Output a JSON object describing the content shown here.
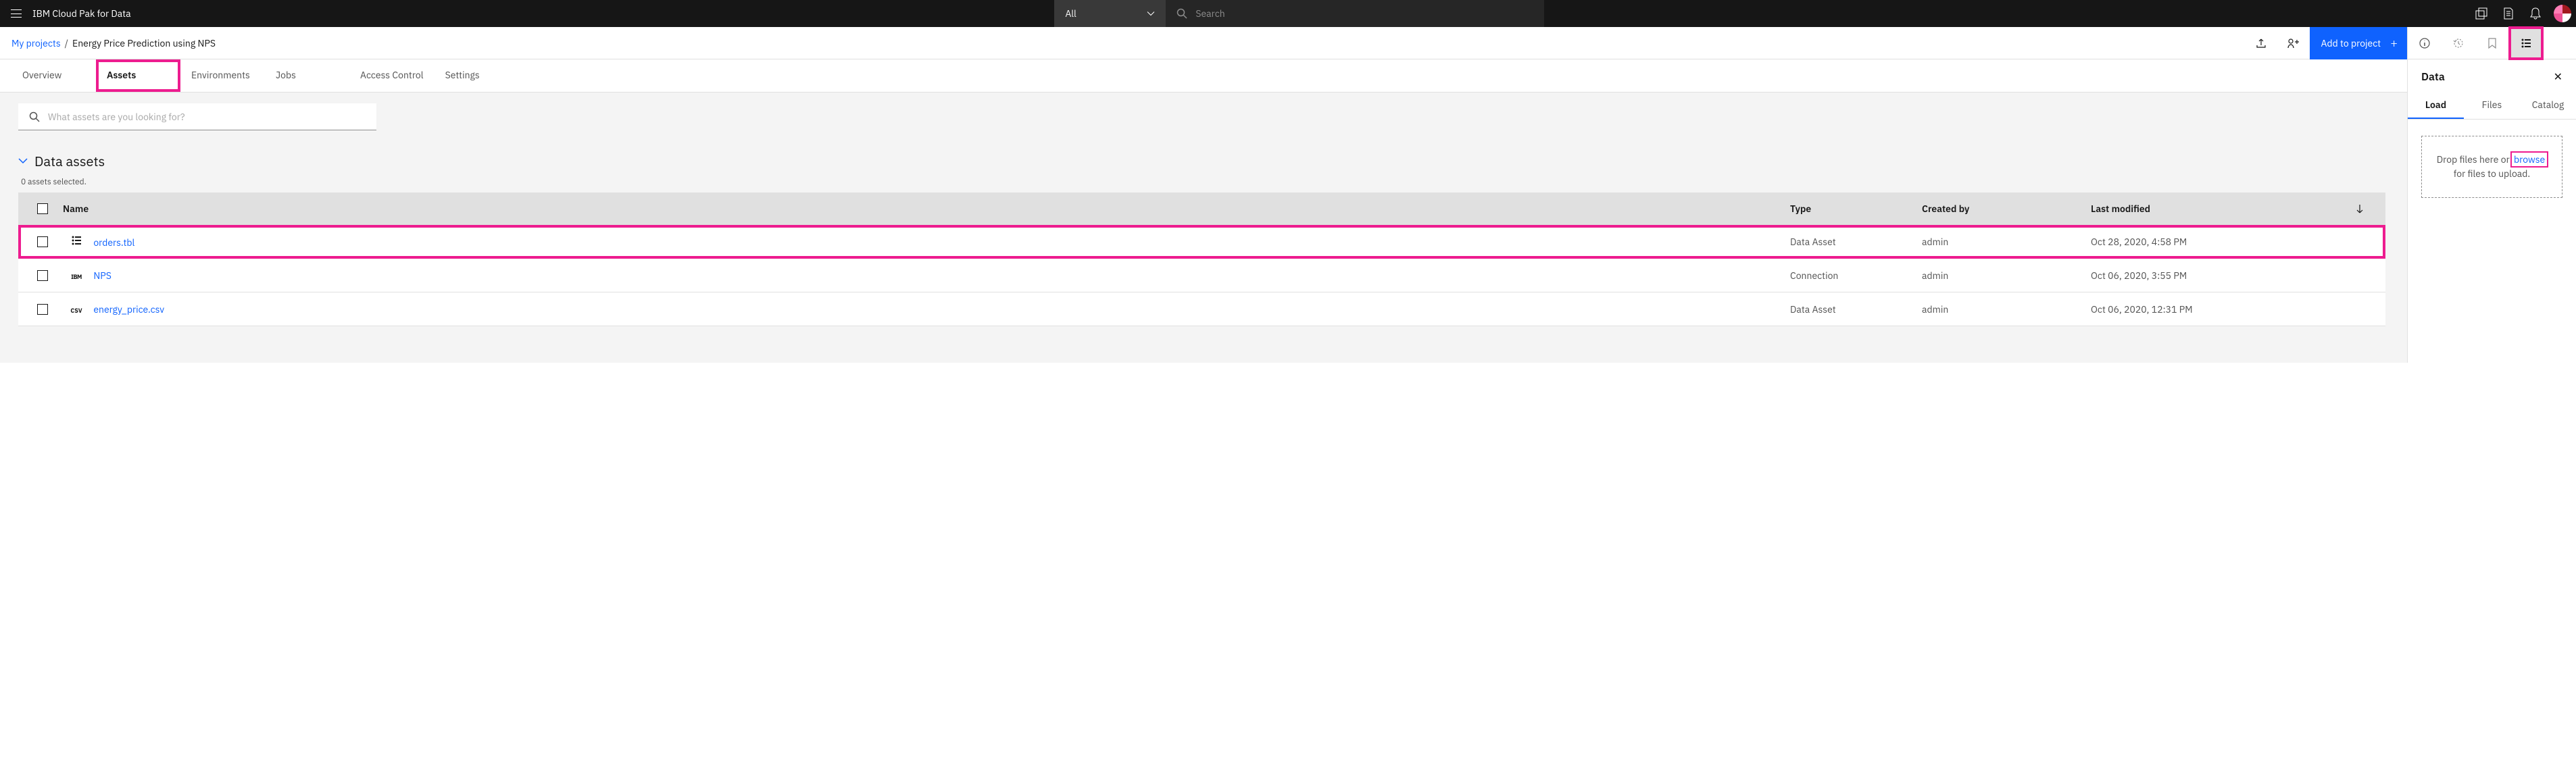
{
  "header": {
    "app_title": "IBM Cloud Pak for Data",
    "filter": "All",
    "search_placeholder": "Search"
  },
  "breadcrumb": {
    "root": "My projects",
    "current": "Energy Price Prediction using NPS"
  },
  "actions": {
    "add_to_project": "Add to project"
  },
  "tabs": [
    {
      "label": "Overview",
      "active": false
    },
    {
      "label": "Assets",
      "active": true
    },
    {
      "label": "Environments",
      "active": false
    },
    {
      "label": "Jobs",
      "active": false
    },
    {
      "label": "Access Control",
      "active": false
    },
    {
      "label": "Settings",
      "active": false
    }
  ],
  "asset_search": {
    "placeholder": "What assets are you looking for?"
  },
  "section": {
    "title": "Data assets",
    "selection_count": "0 assets selected."
  },
  "table": {
    "columns": {
      "name": "Name",
      "type": "Type",
      "created_by": "Created by",
      "last_modified": "Last modified"
    },
    "rows": [
      {
        "icon": "data",
        "name": "orders.tbl",
        "type": "Data Asset",
        "created_by": "admin",
        "last_modified": "Oct 28, 2020, 4:58 PM"
      },
      {
        "icon": "ibm",
        "name": "NPS",
        "type": "Connection",
        "created_by": "admin",
        "last_modified": "Oct 06, 2020, 3:55 PM"
      },
      {
        "icon": "csv",
        "name": "energy_price.csv",
        "type": "Data Asset",
        "created_by": "admin",
        "last_modified": "Oct 06, 2020, 12:31 PM"
      }
    ]
  },
  "side_panel": {
    "title": "Data",
    "tabs": [
      {
        "label": "Load",
        "active": true
      },
      {
        "label": "Files",
        "active": false
      },
      {
        "label": "Catalog",
        "active": false
      }
    ],
    "drop_text_pre": "Drop files here or ",
    "drop_browse": "browse",
    "drop_text_post": " for files to upload."
  }
}
